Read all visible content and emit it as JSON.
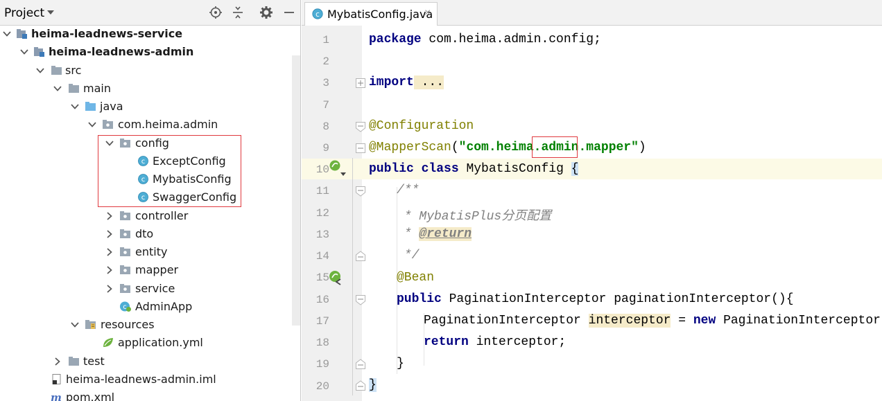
{
  "project_panel": {
    "title": "Project",
    "header_icons": [
      "locate-icon",
      "collapse-all-icon",
      "settings-icon",
      "hide-icon"
    ],
    "tree": [
      {
        "label": "heima-leadnews-service",
        "bold": true,
        "icon": "module-folder-icon",
        "expanded": true
      },
      {
        "label": "heima-leadnews-admin",
        "bold": true,
        "icon": "module-folder-icon",
        "expanded": true
      },
      {
        "label": "src",
        "icon": "folder-icon",
        "expanded": true
      },
      {
        "label": "main",
        "icon": "folder-icon",
        "expanded": true
      },
      {
        "label": "java",
        "icon": "source-folder-icon",
        "expanded": true
      },
      {
        "label": "com.heima.admin",
        "icon": "package-icon",
        "expanded": true
      },
      {
        "label": "config",
        "icon": "package-icon",
        "expanded": true
      },
      {
        "label": "ExceptConfig",
        "icon": "class-icon"
      },
      {
        "label": "MybatisConfig",
        "icon": "class-icon"
      },
      {
        "label": "SwaggerConfig",
        "icon": "class-icon"
      },
      {
        "label": "controller",
        "icon": "package-icon",
        "expanded": false
      },
      {
        "label": "dto",
        "icon": "package-icon",
        "expanded": false
      },
      {
        "label": "entity",
        "icon": "package-icon",
        "expanded": false
      },
      {
        "label": "mapper",
        "icon": "package-icon",
        "expanded": false
      },
      {
        "label": "service",
        "icon": "package-icon",
        "expanded": false
      },
      {
        "label": "AdminApp",
        "icon": "spring-boot-class-icon"
      },
      {
        "label": "resources",
        "icon": "resources-folder-icon",
        "expanded": true
      },
      {
        "label": "application.yml",
        "icon": "spring-yml-icon"
      },
      {
        "label": "test",
        "icon": "folder-icon",
        "expanded": false
      },
      {
        "label": "heima-leadnews-admin.iml",
        "icon": "iml-file-icon"
      },
      {
        "label": "pom.xml",
        "icon": "maven-icon"
      }
    ]
  },
  "editor": {
    "tab": {
      "label": "MybatisConfig.java",
      "close": "×",
      "icon": "class-icon"
    },
    "line_numbers": [
      "1",
      "2",
      "3",
      "7",
      "8",
      "9",
      "10",
      "11",
      "12",
      "13",
      "14",
      "15",
      "16",
      "17",
      "18",
      "19",
      "20"
    ],
    "code": {
      "l1_kw": "package",
      "l1_rest": " com.heima.admin.config;",
      "l3_kw": "import",
      "l3_rest": " ...",
      "l8": "@Configuration",
      "l9_ann": "@MapperScan",
      "l9_open": "(",
      "l9_str1": "\"com.heima.",
      "l9_str2": "admin",
      "l9_str3": ".mapper\"",
      "l9_close": ")",
      "l10_kw1": "public",
      "l10_kw2": "class",
      "l10_name": " MybatisConfig ",
      "l10_brace": "{",
      "l11": "/**",
      "l12": " * MybatisPlus分页配置",
      "l13_star": " * ",
      "l13_tag": "@return",
      "l14": " */",
      "l15": "@Bean",
      "l16_kw": "public",
      "l16_rest": " PaginationInterceptor paginationInterceptor(){",
      "l17_type": "PaginationInterceptor ",
      "l17_var": "interceptor",
      "l17_eq": " = ",
      "l17_new": "new",
      "l17_rest": " PaginationInterceptor();",
      "l18_kw": "return",
      "l18_rest": " interceptor;",
      "l19": "}",
      "l20": "}"
    }
  },
  "colors": {
    "keyword": "#000080",
    "annotation": "#808000",
    "string": "#008000",
    "comment": "#808080",
    "highlight_box": "#e0393e",
    "current_line": "#fcfae6"
  }
}
